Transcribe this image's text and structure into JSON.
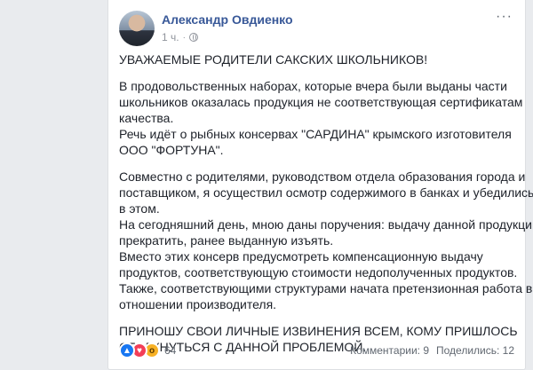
{
  "post": {
    "author": "Александр Овдиенко",
    "time": "1 ч.",
    "separator": "·",
    "more": "···",
    "paragraphs": [
      [
        "УВАЖАЕМЫЕ РОДИТЕЛИ САКСКИХ ШКОЛЬНИКОВ!"
      ],
      [
        "В продовольственных наборах, которые вчера были выданы части",
        "школьников оказалась продукция не соответствующая сертификатам",
        "качества.",
        "Речь идёт о рыбных консервах \"САРДИНА\" крымского изготовителя",
        "ООО \"ФОРТУНА\"."
      ],
      [
        "Совместно с родителями, руководством отдела образования города и",
        "поставщиком, я осуществил осмотр содержимого в банках и убедились",
        "в этом.",
        "На сегодняшний день, мною даны поручения: выдачу данной продукции",
        "прекратить, ранее выданную изъять.",
        "Вместо этих консерв предусмотреть компенсационную выдачу",
        "продуктов, соответствующую стоимости недополученных продуктов.",
        "Также, соответствующими структурами начата претензионная работа в",
        "отношении производителя."
      ],
      [
        "ПРИНОШУ СВОИ ЛИЧНЫЕ ИЗВИНЕНИЯ ВСЕМ, КОМУ ПРИШЛОСЬ",
        "СТОЛКНУТЬСЯ С ДАННОЙ ПРОБЛЕМОЙ."
      ]
    ]
  },
  "footer": {
    "reactions": [
      {
        "icon": "like-reaction-icon",
        "glyph": "👍",
        "color": "#1877f2"
      },
      {
        "icon": "love-reaction-icon",
        "glyph": "♥",
        "color": "#f33e58"
      },
      {
        "icon": "wow-reaction-icon",
        "glyph": "o",
        "color": "#f7b125"
      }
    ],
    "reaction_count": "64",
    "comments": "Комментарии: 9",
    "shares": "Поделились: 12"
  }
}
